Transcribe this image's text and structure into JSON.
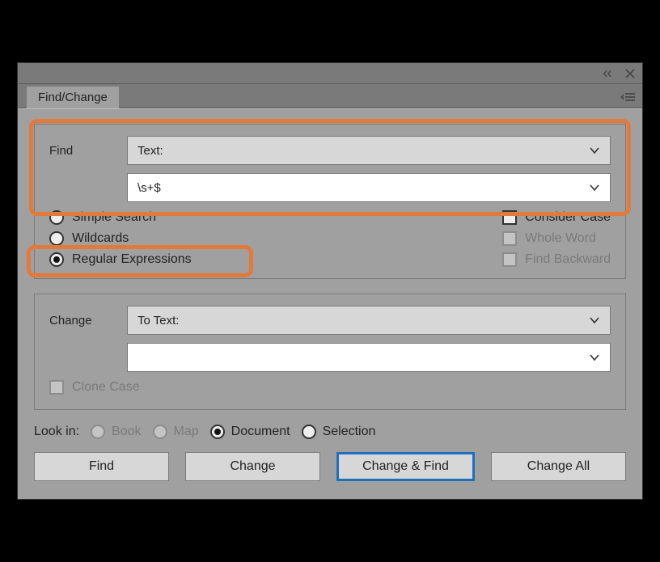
{
  "tab": {
    "label": "Find/Change"
  },
  "find": {
    "label": "Find",
    "type_label": "Text:",
    "value": "\\s+$"
  },
  "searchModes": {
    "simple": "Simple Search",
    "wildcards": "Wildcards",
    "regex": "Regular Expressions"
  },
  "searchOptions": {
    "considerCase": "Consider Case",
    "wholeWord": "Whole Word",
    "findBackward": "Find Backward"
  },
  "change": {
    "label": "Change",
    "type_label": "To Text:",
    "value": "",
    "clone_case": "Clone Case"
  },
  "lookIn": {
    "label": "Look in:",
    "book": "Book",
    "map": "Map",
    "document": "Document",
    "selection": "Selection"
  },
  "buttons": {
    "find": "Find",
    "change": "Change",
    "changeFind": "Change & Find",
    "changeAll": "Change All"
  }
}
